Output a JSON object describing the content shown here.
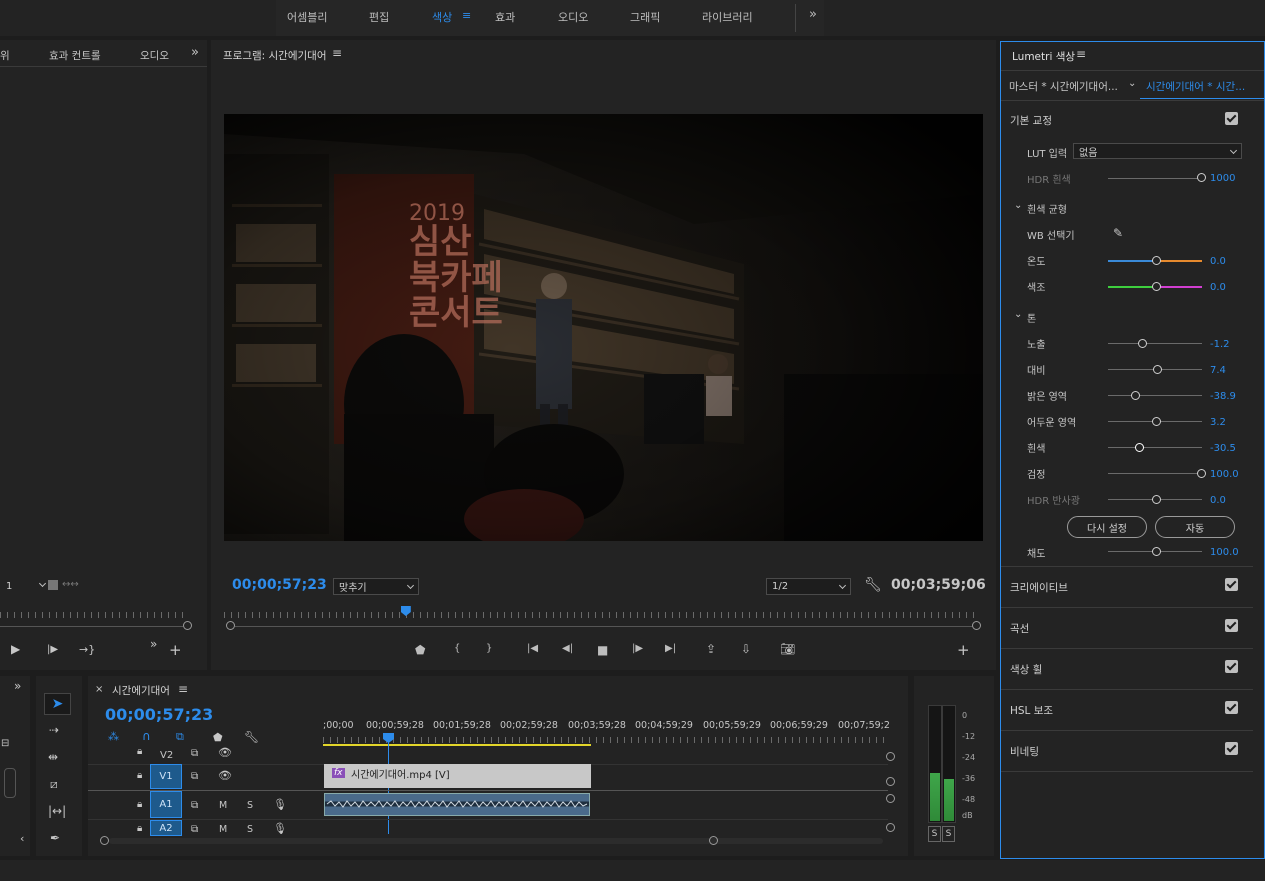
{
  "workspace_tabs": [
    "어셈블리",
    "편집",
    "색상",
    "효과",
    "오디오",
    "그래픽",
    "라이브러리"
  ],
  "workspace_active": "색상",
  "left_panel": {
    "tabs": [
      "위",
      "효과 컨트롤",
      "오디오"
    ],
    "selector_value": "1"
  },
  "program_monitor": {
    "title": "프로그램: 시간에기대어",
    "video_text": {
      "line1": "2019",
      "line2": "심산",
      "line3": "북카페",
      "line4": "콘서트"
    },
    "current_timecode": "00;00;57;23",
    "fit_option": "맞추기",
    "resolution": "1/2",
    "duration_timecode": "00;03;59;06",
    "playhead_fraction": 0.234
  },
  "lumetri": {
    "title": "Lumetri 색상",
    "tab_master": "마스터 * 시간에기대어...",
    "tab_clip": "시간에기대어 * 시간...",
    "basic_correction": "기본 교정",
    "lut_label": "LUT 입력",
    "lut_value": "없음",
    "hdr_white_label": "HDR 흰색",
    "hdr_white_value": "1000",
    "wb_section": "흰색 균형",
    "wb_picker": "WB 선택기",
    "temp_label": "온도",
    "temp_value": "0.0",
    "tint_label": "색조",
    "tint_value": "0.0",
    "tone_section": "톤",
    "sliders": [
      {
        "label": "노출",
        "value": "-1.2"
      },
      {
        "label": "대비",
        "value": "7.4"
      },
      {
        "label": "밝은 영역",
        "value": "-38.9"
      },
      {
        "label": "어두운 영역",
        "value": "3.2"
      },
      {
        "label": "흰색",
        "value": "-30.5"
      },
      {
        "label": "검정",
        "value": "100.0"
      },
      {
        "label": "HDR 반사광",
        "value": "0.0"
      }
    ],
    "reset_button": "다시 설정",
    "auto_button": "자동",
    "saturation_label": "채도",
    "saturation_value": "100.0",
    "sections": [
      "크리에이티브",
      "곡선",
      "색상 휠",
      "HSL 보조",
      "비네팅"
    ]
  },
  "timeline": {
    "title": "시간에기대어",
    "timecode": "00;00;57;23",
    "ruler_labels": [
      ";00;00",
      "00;00;59;28",
      "00;01;59;28",
      "00;02;59;28",
      "00;03;59;28",
      "00;04;59;29",
      "00;05;59;29",
      "00;06;59;29",
      "00;07;59;2"
    ],
    "tracks": {
      "v2": "V2",
      "v1": "V1",
      "a1": "A1",
      "a2": "A2",
      "m": "M",
      "s": "S"
    },
    "clip_name": "시간에기대어.mp4 [V]",
    "fx_badge": "fx"
  },
  "audio_meter": {
    "scale": [
      "0",
      "-12",
      "-24",
      "-36",
      "-48",
      "dB"
    ],
    "solo": [
      "S",
      "S"
    ]
  }
}
